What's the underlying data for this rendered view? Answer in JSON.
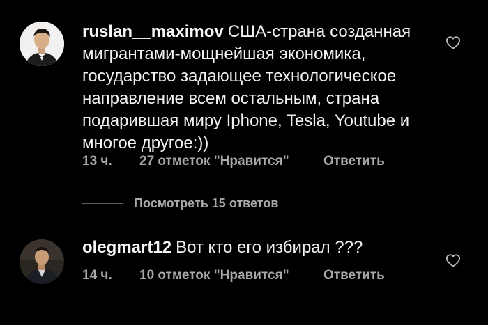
{
  "comments": [
    {
      "username": "ruslan__maximov",
      "text": "США-страна созданная мигрантами-мощнейшая экономика, государство задающее технологическое направление всем остальным, страна подарившая миру Iphone, Tesla, Youtube и многое другое:))",
      "time": "13 ч.",
      "likes": "27 отметок \"Нравится\"",
      "reply_label": "Ответить",
      "like_icon": "heart-outline-icon"
    },
    {
      "username": "olegmart12",
      "text": "Вот кто его избирал ???",
      "time": "14 ч.",
      "likes": "10 отметок \"Нравится\"",
      "reply_label": "Ответить",
      "like_icon": "heart-outline-icon"
    }
  ],
  "view_replies_label": "Посмотреть 15 ответов",
  "colors": {
    "background": "#000000",
    "text": "#f2f2f2",
    "secondary": "#a8a8a8"
  }
}
